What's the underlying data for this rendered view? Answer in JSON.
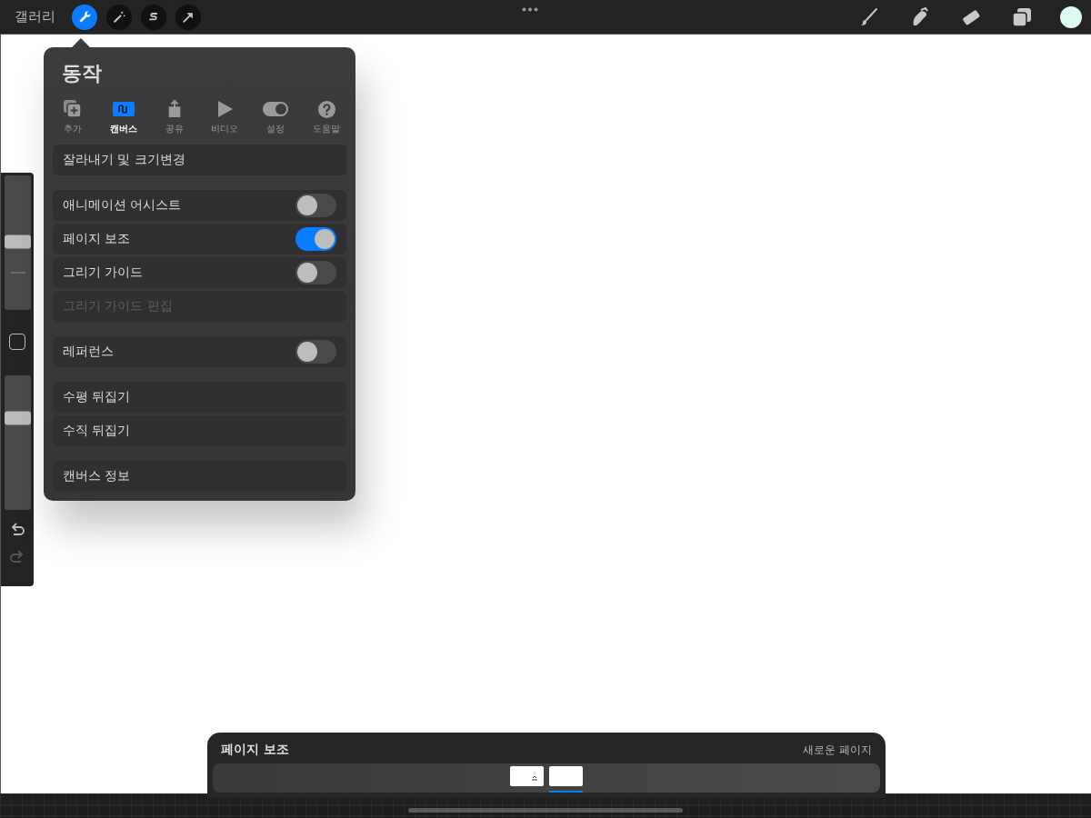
{
  "toolbar": {
    "gallery": "갤러리",
    "left_tools": [
      {
        "kind": "wrench",
        "selected": true
      },
      {
        "kind": "wand",
        "selected": false
      },
      {
        "kind": "s-curve",
        "selected": false
      },
      {
        "kind": "arrow",
        "selected": false
      }
    ],
    "right_tools": [
      {
        "kind": "brush"
      },
      {
        "kind": "smudge"
      },
      {
        "kind": "eraser"
      },
      {
        "kind": "layers"
      }
    ],
    "current_color": {
      "color": "#dcfaf2"
    }
  },
  "popover": {
    "title": "동작",
    "tabs": [
      {
        "kind": "add",
        "label": "추가",
        "selected": false
      },
      {
        "kind": "canvas",
        "label": "캔버스",
        "selected": true
      },
      {
        "kind": "share",
        "label": "공유",
        "selected": false
      },
      {
        "kind": "video",
        "label": "비디오",
        "selected": false
      },
      {
        "kind": "settings",
        "label": "설정",
        "selected": false
      },
      {
        "kind": "help",
        "label": "도움말",
        "selected": false
      }
    ],
    "groups": [
      {
        "rows": [
          {
            "kind": "action",
            "label": "잘라내기 및 크기변경",
            "disabled": false
          }
        ]
      },
      {
        "rows": [
          {
            "kind": "toggle",
            "label": "애니메이션 어시스트",
            "on": false,
            "disabled": false
          },
          {
            "kind": "toggle",
            "label": "페이지 보조",
            "on": true,
            "disabled": false
          },
          {
            "kind": "toggle",
            "label": "그리기 가이드",
            "on": false,
            "disabled": false
          },
          {
            "kind": "action",
            "label": "그리기 가이드 편집",
            "disabled": true
          }
        ]
      },
      {
        "rows": [
          {
            "kind": "toggle",
            "label": "레퍼런스",
            "on": false,
            "disabled": false
          }
        ]
      },
      {
        "rows": [
          {
            "kind": "action",
            "label": "수평 뒤집기",
            "disabled": false
          },
          {
            "kind": "action",
            "label": "수직 뒤집기",
            "disabled": false
          }
        ]
      },
      {
        "rows": [
          {
            "kind": "action",
            "label": "캔버스 정보",
            "disabled": false
          }
        ]
      }
    ]
  },
  "sidebar": {
    "sliders": [
      {
        "kind": "brush-size",
        "level": 0.51
      },
      {
        "kind": "opacity",
        "level": 0.68
      }
    ],
    "undo": {
      "disabled": false
    },
    "redo": {
      "disabled": true
    }
  },
  "page_assist": {
    "title": "페이지 보조",
    "new_page": "새로운 페이지",
    "pages": [
      {
        "selected": false
      },
      {
        "selected": true
      }
    ]
  }
}
